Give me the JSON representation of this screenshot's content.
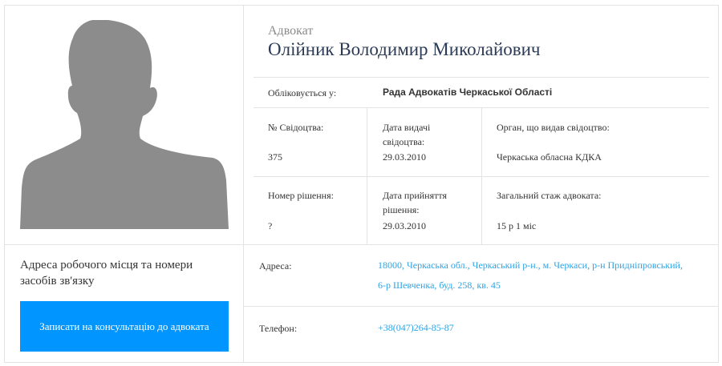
{
  "profile": {
    "role": "Адвокат",
    "full_name": "Олійник Володимир Миколайович",
    "photo_icon": "person-silhouette-icon"
  },
  "registry": {
    "label": "Обліковується у:",
    "value": "Рада Адвокатів Черкаської Області"
  },
  "certificate": {
    "number_label": "№ Свідоцтва:",
    "number_value": "375",
    "issue_date_label_1": "Дата видачі",
    "issue_date_label_2": "свідоцтва:",
    "issue_date_value": "29.03.2010",
    "issuer_label": "Орган, що видав свідоцтво:",
    "issuer_value": "Черкаська обласна КДКА"
  },
  "decision": {
    "number_label": "Номер рішення:",
    "number_value": "?",
    "date_label_1": "Дата прийняття",
    "date_label_2": "рішення:",
    "date_value": "29.03.2010",
    "experience_label": "Загальний стаж адвоката:",
    "experience_value": "15 р 1 міс"
  },
  "contacts": {
    "section_title": "Адреса робочого місця та номери засобів зв'язку",
    "consult_button": "Записати на консультацію до адвоката",
    "address_label": "Адреса:",
    "address_line_1": "18000, Черкаська обл., Черкаський р-н., м. Черкаси, р-н Придніпровський,",
    "address_line_2": "6-р Шевченка, буд. 258, кв. 45",
    "phone_label": "Телефон:",
    "phone_value": "+38(047)264-85-87"
  },
  "colors": {
    "accent": "#0095ff",
    "link": "#2ea3e3",
    "name": "#2b3a55",
    "silhouette": "#8c8c8c"
  }
}
